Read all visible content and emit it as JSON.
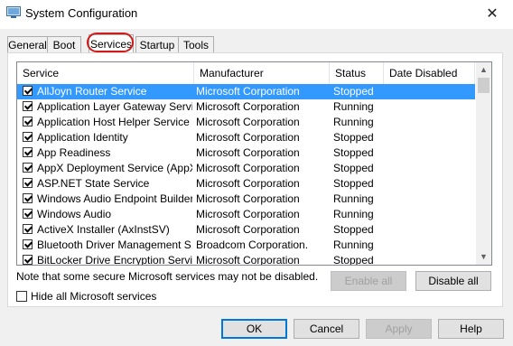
{
  "window": {
    "title": "System Configuration"
  },
  "tabs": [
    {
      "label": "General",
      "active": false
    },
    {
      "label": "Boot",
      "active": false
    },
    {
      "label": "Services",
      "active": true
    },
    {
      "label": "Startup",
      "active": false
    },
    {
      "label": "Tools",
      "active": false
    }
  ],
  "columns": [
    "Service",
    "Manufacturer",
    "Status",
    "Date Disabled"
  ],
  "services": [
    {
      "name": "AllJoyn Router Service",
      "manufacturer": "Microsoft Corporation",
      "status": "Stopped",
      "date": "",
      "checked": true,
      "selected": true
    },
    {
      "name": "Application Layer Gateway Service",
      "manufacturer": "Microsoft Corporation",
      "status": "Running",
      "date": "",
      "checked": true
    },
    {
      "name": "Application Host Helper Service",
      "manufacturer": "Microsoft Corporation",
      "status": "Running",
      "date": "",
      "checked": true
    },
    {
      "name": "Application Identity",
      "manufacturer": "Microsoft Corporation",
      "status": "Stopped",
      "date": "",
      "checked": true
    },
    {
      "name": "App Readiness",
      "manufacturer": "Microsoft Corporation",
      "status": "Stopped",
      "date": "",
      "checked": true
    },
    {
      "name": "AppX Deployment Service (AppX...",
      "manufacturer": "Microsoft Corporation",
      "status": "Stopped",
      "date": "",
      "checked": true
    },
    {
      "name": "ASP.NET State Service",
      "manufacturer": "Microsoft Corporation",
      "status": "Stopped",
      "date": "",
      "checked": true
    },
    {
      "name": "Windows Audio Endpoint Builder",
      "manufacturer": "Microsoft Corporation",
      "status": "Running",
      "date": "",
      "checked": true
    },
    {
      "name": "Windows Audio",
      "manufacturer": "Microsoft Corporation",
      "status": "Running",
      "date": "",
      "checked": true
    },
    {
      "name": "ActiveX Installer (AxInstSV)",
      "manufacturer": "Microsoft Corporation",
      "status": "Stopped",
      "date": "",
      "checked": true
    },
    {
      "name": "Bluetooth Driver Management S...",
      "manufacturer": "Broadcom Corporation.",
      "status": "Running",
      "date": "",
      "checked": true
    },
    {
      "name": "BitLocker Drive Encryption Service",
      "manufacturer": "Microsoft Corporation",
      "status": "Stopped",
      "date": "",
      "checked": true
    }
  ],
  "note": "Note that some secure Microsoft services may not be disabled.",
  "buttons": {
    "enable_all": "Enable all",
    "disable_all": "Disable all",
    "ok": "OK",
    "cancel": "Cancel",
    "apply": "Apply",
    "help": "Help"
  },
  "hide_ms": {
    "label": "Hide all Microsoft services",
    "checked": false
  },
  "colors": {
    "selection": "#3399ff",
    "highlight_circle": "#d11a1a",
    "default_button_border": "#0078d7"
  }
}
